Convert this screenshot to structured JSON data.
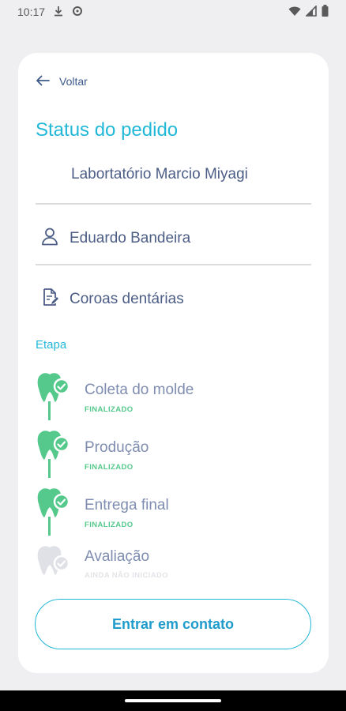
{
  "status_bar": {
    "time": "10:17"
  },
  "header": {
    "back_label": "Voltar",
    "title": "Status do pedido",
    "lab_name": "Labortatório Marcio Miyagi"
  },
  "info": {
    "patient_name": "Eduardo Bandeira",
    "service_name": "Coroas dentárias"
  },
  "stages": {
    "section_label": "Etapa",
    "items": [
      {
        "name": "Coleta do molde",
        "status": "FINALIZADO"
      },
      {
        "name": "Produção",
        "status": "FINALIZADO"
      },
      {
        "name": "Entrega final",
        "status": "FINALIZADO"
      },
      {
        "name": "Avaliação",
        "status": "AINDA NÃO INICIADO"
      }
    ]
  },
  "actions": {
    "contact_label": "Entrar em contato"
  },
  "colors": {
    "accent": "#22b8d8",
    "done": "#54c98b",
    "pending": "#dfe1e6",
    "text": "#4c5d86"
  }
}
